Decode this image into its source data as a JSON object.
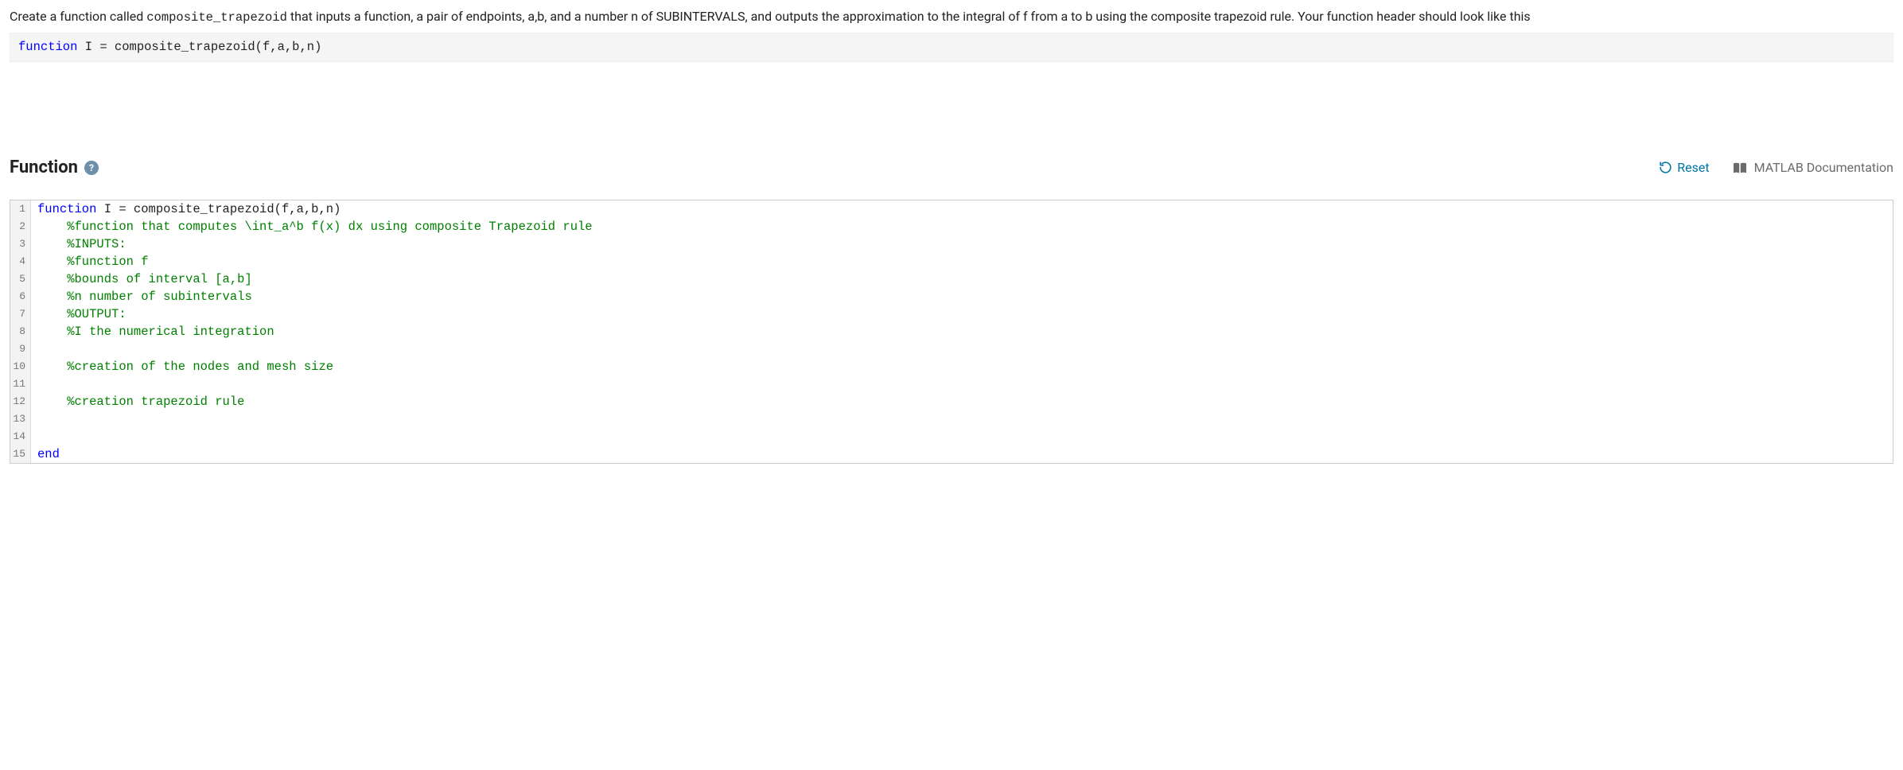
{
  "instructions": {
    "part1": "Create a function called ",
    "code": "composite_trapezoid",
    "part2": " that inputs a function, a pair of endpoints, a,b, and a number n of SUBINTERVALS, and outputs the approximation to the integral of f from a to b using the composite trapezoid rule. Your function header should look like this"
  },
  "header_code": {
    "kw": "function",
    "rest": " I = composite_trapezoid(f,a,b,n)"
  },
  "section": {
    "title": "Function",
    "help": "?",
    "reset": "Reset",
    "doc": "MATLAB Documentation"
  },
  "editor": {
    "lines": [
      {
        "n": "1",
        "tokens": [
          {
            "t": "function",
            "c": "kw"
          },
          {
            "t": " I = composite_trapezoid(f,a,b,n)",
            "c": "def"
          }
        ]
      },
      {
        "n": "2",
        "tokens": [
          {
            "t": "    %function that computes \\int_a^b f(x) dx using composite Trapezoid rule",
            "c": "cm"
          }
        ]
      },
      {
        "n": "3",
        "tokens": [
          {
            "t": "    %INPUTS:",
            "c": "cm"
          }
        ]
      },
      {
        "n": "4",
        "tokens": [
          {
            "t": "    %function f",
            "c": "cm"
          }
        ]
      },
      {
        "n": "5",
        "tokens": [
          {
            "t": "    %bounds of interval [a,b]",
            "c": "cm"
          }
        ]
      },
      {
        "n": "6",
        "tokens": [
          {
            "t": "    %n number of subintervals",
            "c": "cm"
          }
        ]
      },
      {
        "n": "7",
        "tokens": [
          {
            "t": "    %OUTPUT:",
            "c": "cm"
          }
        ]
      },
      {
        "n": "8",
        "tokens": [
          {
            "t": "    %I the numerical integration",
            "c": "cm"
          }
        ]
      },
      {
        "n": "9",
        "tokens": [
          {
            "t": "",
            "c": "def"
          }
        ]
      },
      {
        "n": "10",
        "tokens": [
          {
            "t": "    %creation of the nodes and mesh size",
            "c": "cm"
          }
        ]
      },
      {
        "n": "11",
        "tokens": [
          {
            "t": "",
            "c": "def"
          }
        ]
      },
      {
        "n": "12",
        "tokens": [
          {
            "t": "    %creation trapezoid rule",
            "c": "cm"
          }
        ]
      },
      {
        "n": "13",
        "tokens": [
          {
            "t": "",
            "c": "def"
          }
        ]
      },
      {
        "n": "14",
        "tokens": [
          {
            "t": "",
            "c": "def"
          }
        ]
      },
      {
        "n": "15",
        "tokens": [
          {
            "t": "end",
            "c": "kw"
          }
        ]
      }
    ]
  }
}
